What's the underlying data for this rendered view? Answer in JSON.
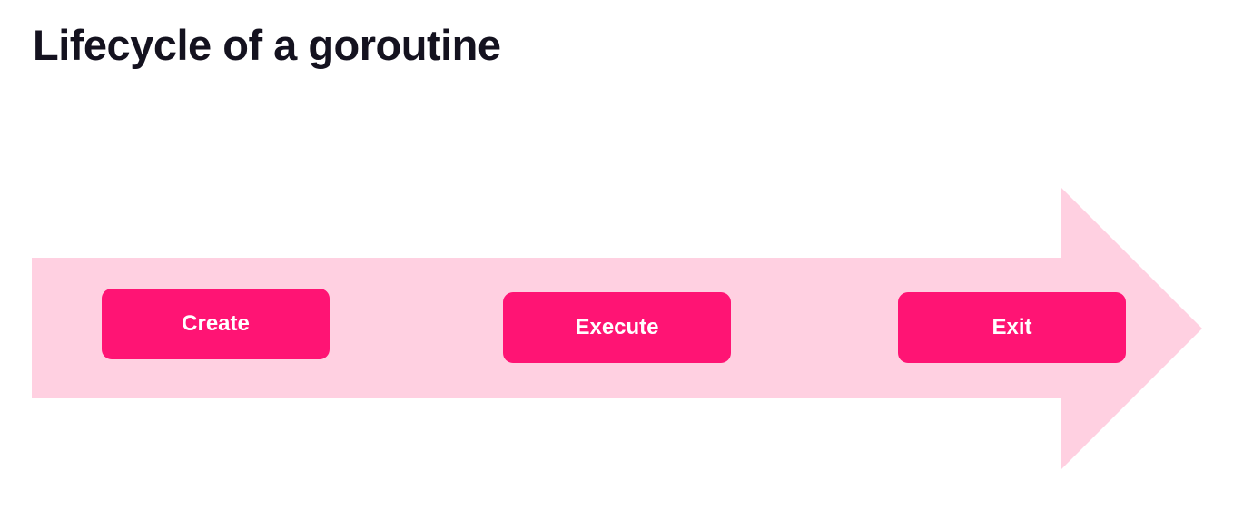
{
  "title": "Lifecycle of a goroutine",
  "colors": {
    "arrow": "#ffd0e1",
    "step": "#ff1474",
    "title": "#14121f",
    "step_text": "#ffffff"
  },
  "steps": [
    {
      "label": "Create"
    },
    {
      "label": "Execute"
    },
    {
      "label": "Exit"
    }
  ]
}
